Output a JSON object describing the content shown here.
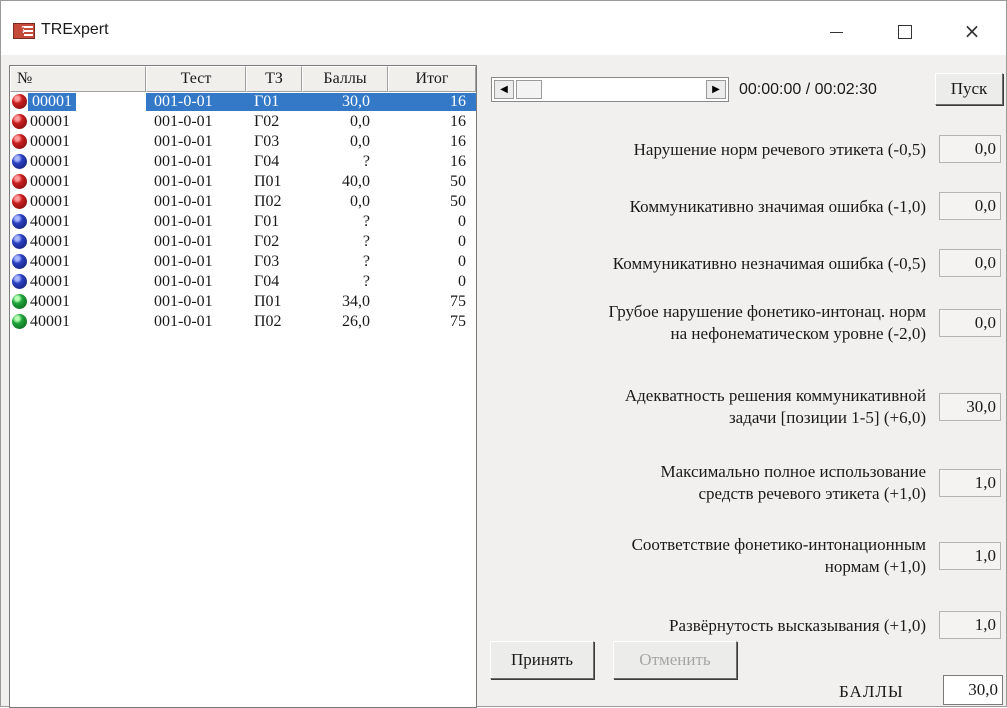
{
  "window": {
    "title": "TRExpert",
    "close_glyph": "×"
  },
  "table": {
    "headers": [
      "№",
      "Тест",
      "ТЗ",
      "Баллы",
      "Итог"
    ],
    "rows": [
      {
        "no": "00001",
        "test": "001-0-01",
        "tz": "Г01",
        "score": "30,0",
        "total": "16",
        "status": "red",
        "selected": true
      },
      {
        "no": "00001",
        "test": "001-0-01",
        "tz": "Г02",
        "score": "0,0",
        "total": "16",
        "status": "red"
      },
      {
        "no": "00001",
        "test": "001-0-01",
        "tz": "Г03",
        "score": "0,0",
        "total": "16",
        "status": "red"
      },
      {
        "no": "00001",
        "test": "001-0-01",
        "tz": "Г04",
        "score": "?",
        "total": "16",
        "status": "blue"
      },
      {
        "no": "00001",
        "test": "001-0-01",
        "tz": "П01",
        "score": "40,0",
        "total": "50",
        "status": "red"
      },
      {
        "no": "00001",
        "test": "001-0-01",
        "tz": "П02",
        "score": "0,0",
        "total": "50",
        "status": "red"
      },
      {
        "no": "40001",
        "test": "001-0-01",
        "tz": "Г01",
        "score": "?",
        "total": "0",
        "status": "blue"
      },
      {
        "no": "40001",
        "test": "001-0-01",
        "tz": "Г02",
        "score": "?",
        "total": "0",
        "status": "blue"
      },
      {
        "no": "40001",
        "test": "001-0-01",
        "tz": "Г03",
        "score": "?",
        "total": "0",
        "status": "blue"
      },
      {
        "no": "40001",
        "test": "001-0-01",
        "tz": "Г04",
        "score": "?",
        "total": "0",
        "status": "blue"
      },
      {
        "no": "40001",
        "test": "001-0-01",
        "tz": "П01",
        "score": "34,0",
        "total": "75",
        "status": "green"
      },
      {
        "no": "40001",
        "test": "001-0-01",
        "tz": "П02",
        "score": "26,0",
        "total": "75",
        "status": "green"
      }
    ]
  },
  "player": {
    "time": "00:00:00 / 00:02:30",
    "start_label": "Пуск",
    "arrow_left": "◀",
    "arrow_right": "▶"
  },
  "criteria": [
    {
      "label": "Нарушение норм речевого этикета (-0,5)",
      "value": "0,0"
    },
    {
      "label": "Коммуникативно значимая ошибка (-1,0)",
      "value": "0,0"
    },
    {
      "label": "Коммуникативно незначимая ошибка (-0,5)",
      "value": "0,0"
    },
    {
      "label": "Грубое нарушение фонетико-интонац. норм\nна нефонематическом уровне (-2,0)",
      "value": "0,0"
    },
    {
      "label": "Адекватность решения коммуникативной\nзадачи [позиции 1-5] (+6,0)",
      "value": "30,0"
    },
    {
      "label": "Максимально полное использование\nсредств речевого этикета (+1,0)",
      "value": "1,0"
    },
    {
      "label": "Соответствие фонетико-интонационным\nнормам (+1,0)",
      "value": "1,0"
    },
    {
      "label": "Развёрнутость высказывания (+1,0)",
      "value": "1,0"
    }
  ],
  "footer": {
    "accept_label": "Принять",
    "cancel_label": "Отменить",
    "score_label": "БАЛЛЫ",
    "score_value": "30,0"
  }
}
